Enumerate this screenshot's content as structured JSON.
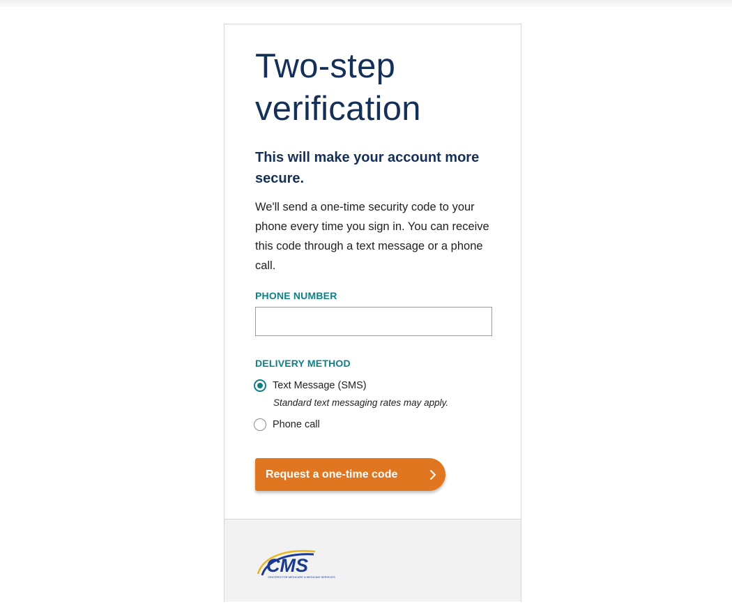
{
  "page": {
    "title": "Two-step verification",
    "subtitle": "This will make your account more secure.",
    "description": "We'll send a one-time security code to your phone every time you sign in. You can receive this code through a text message or a phone call."
  },
  "form": {
    "phone_label": "PHONE NUMBER",
    "phone_value": "",
    "delivery_label": "DELIVERY METHOD",
    "options": [
      {
        "label": "Text Message (SMS)",
        "hint": "Standard text messaging rates may apply.",
        "selected": true
      },
      {
        "label": "Phone call",
        "selected": false
      }
    ],
    "submit_label": "Request a one-time code"
  },
  "footer": {
    "logo_text": "CMS",
    "logo_subtext": "CENTERS FOR MEDICARE & MEDICAID SERVICES"
  },
  "colors": {
    "heading": "#143057",
    "label_teal": "#0f7f86",
    "button_orange": "#e07720",
    "footer_bg": "#f2f2f2"
  },
  "icons": {
    "button_icon": "chevron-right-icon",
    "logo": "cms-logo"
  }
}
